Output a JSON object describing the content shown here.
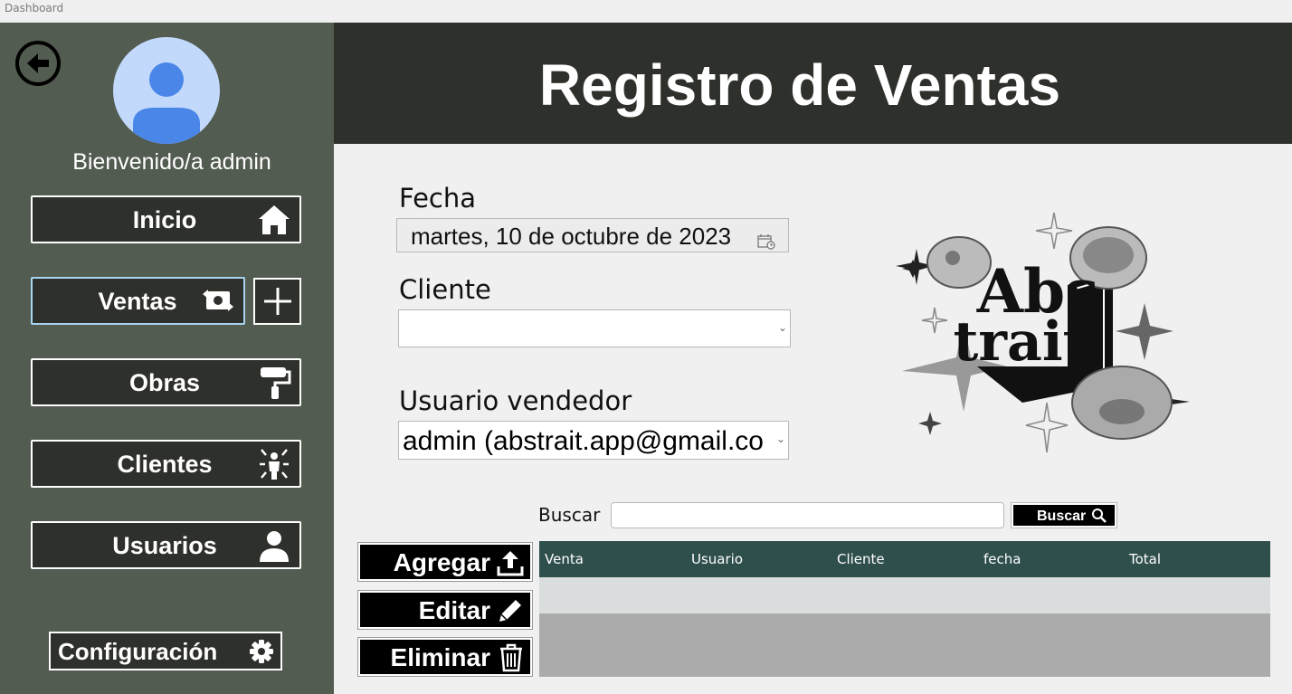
{
  "window": {
    "title": "Dashboard"
  },
  "sidebar": {
    "welcome": "Bienvenido/a admin",
    "items": [
      {
        "label": "Inicio",
        "icon": "home-icon"
      },
      {
        "label": "Ventas",
        "icon": "money-exchange-icon",
        "selected": true
      },
      {
        "label": "Obras",
        "icon": "paint-roller-icon"
      },
      {
        "label": "Clientes",
        "icon": "person-burst-icon"
      },
      {
        "label": "Usuarios",
        "icon": "user-icon"
      }
    ],
    "add_icon": "plus-icon",
    "back_icon": "arrow-left-circle-icon",
    "config": {
      "label": "Configuración",
      "icon": "gear-icon"
    }
  },
  "header": {
    "title": "Registro de Ventas"
  },
  "form": {
    "fecha_label": "Fecha",
    "fecha_value": "martes, 10 de octubre de 2023",
    "cliente_label": "Cliente",
    "cliente_value": "",
    "vendedor_label": "Usuario vendedor",
    "vendedor_value": "admin (abstrait.app@gmail.co"
  },
  "logo": {
    "line1": "Abs",
    "line2": "trait"
  },
  "search": {
    "label": "Buscar",
    "value": "",
    "button_label": "Buscar"
  },
  "actions": [
    {
      "label": "Agregar",
      "icon": "upload-icon"
    },
    {
      "label": "Editar",
      "icon": "pencil-icon"
    },
    {
      "label": "Eliminar",
      "icon": "trash-icon"
    }
  ],
  "table": {
    "columns": [
      "Venta",
      "Usuario",
      "Cliente",
      "fecha",
      "Total"
    ],
    "rows": []
  },
  "colors": {
    "sidebar_bg": "#535c51",
    "header_bg": "#2e302b",
    "table_header_bg": "#2f4f4d",
    "selected_border": "#a8d4f0"
  }
}
